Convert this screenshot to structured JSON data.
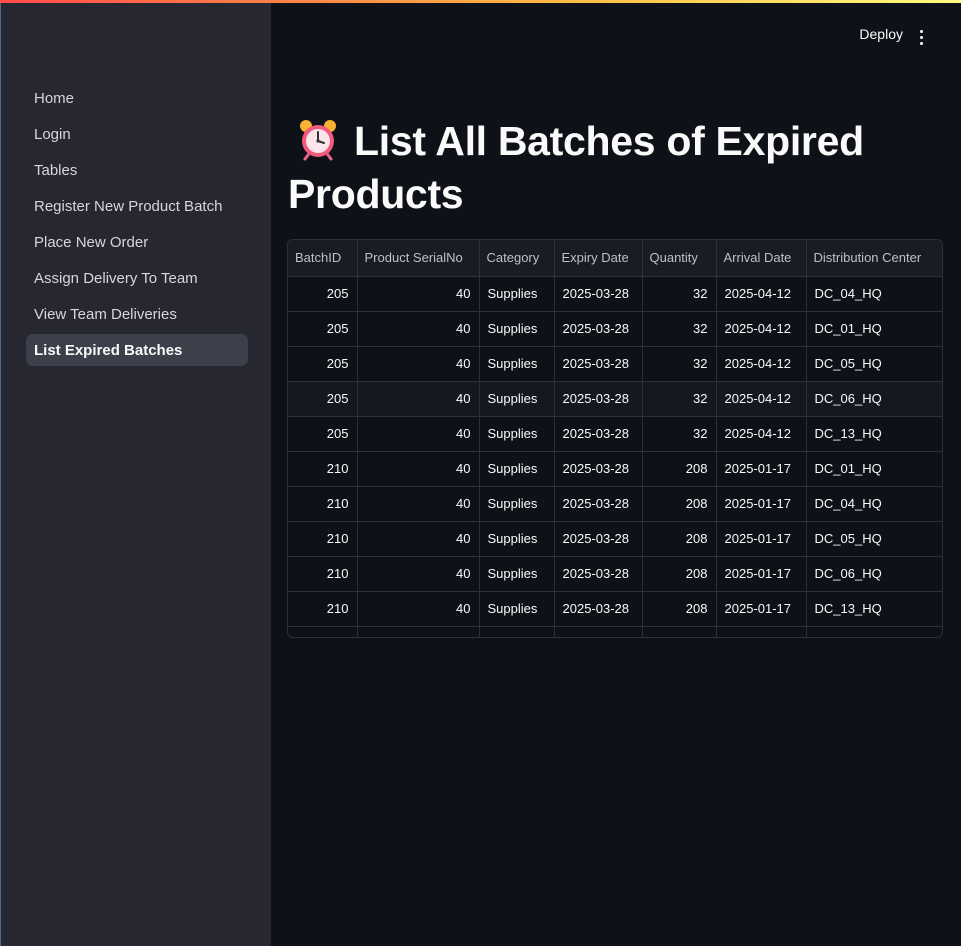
{
  "sidebar": {
    "items": [
      {
        "label": "Home",
        "active": false
      },
      {
        "label": "Login",
        "active": false
      },
      {
        "label": "Tables",
        "active": false
      },
      {
        "label": "Register New Product Batch",
        "active": false
      },
      {
        "label": "Place New Order",
        "active": false
      },
      {
        "label": "Assign Delivery To Team",
        "active": false
      },
      {
        "label": "View Team Deliveries",
        "active": false
      },
      {
        "label": "List Expired Batches",
        "active": true
      }
    ]
  },
  "header": {
    "deploy_label": "Deploy",
    "menu_icon": "kebab-menu-icon"
  },
  "main": {
    "title_icon": "alarm-clock-icon",
    "title": "List All Batches of Expired Products",
    "table": {
      "columns": [
        "BatchID",
        "Product SerialNo",
        "Category",
        "Expiry Date",
        "Quantity",
        "Arrival Date",
        "Distribution Center"
      ],
      "rows": [
        [
          "205",
          "40",
          "Supplies",
          "2025-03-28",
          "32",
          "2025-04-12",
          "DC_04_HQ"
        ],
        [
          "205",
          "40",
          "Supplies",
          "2025-03-28",
          "32",
          "2025-04-12",
          "DC_01_HQ"
        ],
        [
          "205",
          "40",
          "Supplies",
          "2025-03-28",
          "32",
          "2025-04-12",
          "DC_05_HQ"
        ],
        [
          "205",
          "40",
          "Supplies",
          "2025-03-28",
          "32",
          "2025-04-12",
          "DC_06_HQ"
        ],
        [
          "205",
          "40",
          "Supplies",
          "2025-03-28",
          "32",
          "2025-04-12",
          "DC_13_HQ"
        ],
        [
          "210",
          "40",
          "Supplies",
          "2025-03-28",
          "208",
          "2025-01-17",
          "DC_01_HQ"
        ],
        [
          "210",
          "40",
          "Supplies",
          "2025-03-28",
          "208",
          "2025-01-17",
          "DC_04_HQ"
        ],
        [
          "210",
          "40",
          "Supplies",
          "2025-03-28",
          "208",
          "2025-01-17",
          "DC_05_HQ"
        ],
        [
          "210",
          "40",
          "Supplies",
          "2025-03-28",
          "208",
          "2025-01-17",
          "DC_06_HQ"
        ],
        [
          "210",
          "40",
          "Supplies",
          "2025-03-28",
          "208",
          "2025-01-17",
          "DC_13_HQ"
        ]
      ]
    }
  },
  "colors": {
    "accent_gradient_start": "#ff4b4b",
    "accent_gradient_end": "#fffd80",
    "sidebar_bg": "#262730",
    "main_bg": "#0e1117"
  }
}
